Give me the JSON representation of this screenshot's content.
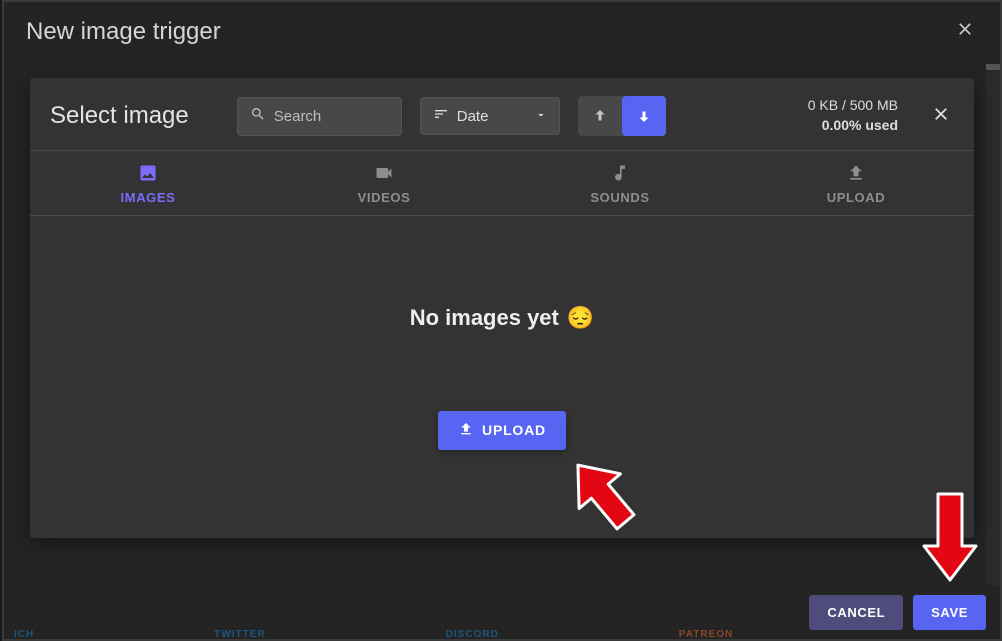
{
  "outer": {
    "title": "New image trigger",
    "footer": {
      "cancel": "CANCEL",
      "save": "SAVE"
    }
  },
  "inner": {
    "title": "Select image",
    "search": {
      "placeholder": "Search"
    },
    "sort": {
      "label": "Date"
    },
    "storage": {
      "line1": "0 KB / 500 MB",
      "line2": "0.00% used"
    },
    "tabs": {
      "images": "IMAGES",
      "videos": "VIDEOS",
      "sounds": "SOUNDS",
      "upload": "UPLOAD"
    },
    "empty": {
      "text": "No images yet",
      "emoji": "😔"
    },
    "uploadButton": "UPLOAD"
  },
  "bottombar": {
    "a": "ICH",
    "b": "TWITTER",
    "c": "DISCORD",
    "d": "PATREON"
  }
}
